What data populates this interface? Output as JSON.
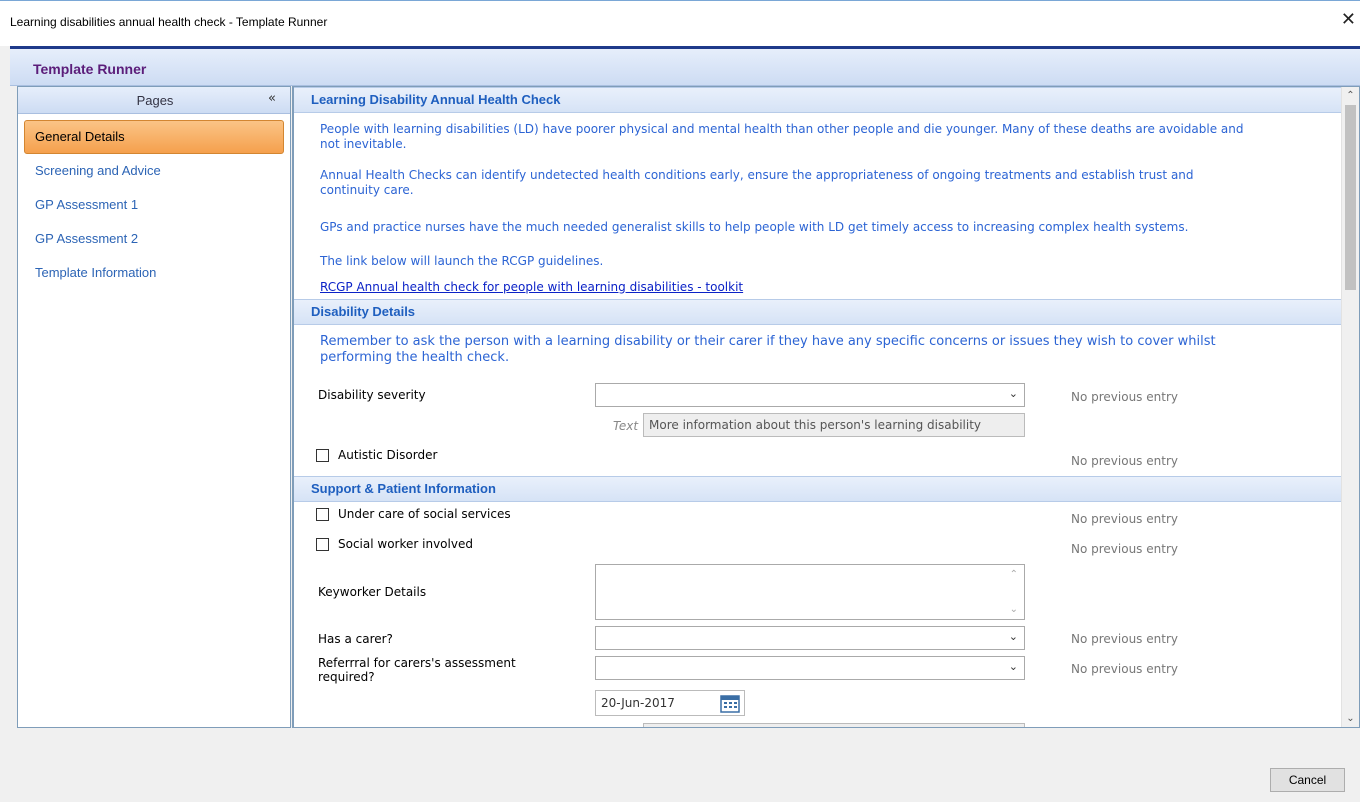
{
  "window": {
    "title": "Learning disabilities annual health check - Template Runner",
    "close_glyph": "✕"
  },
  "runner": {
    "title": "Template Runner"
  },
  "sidebar": {
    "header": "Pages",
    "collapse_glyph": "«",
    "items": [
      {
        "label": "General Details",
        "active": true
      },
      {
        "label": "Screening and Advice"
      },
      {
        "label": "GP Assessment 1"
      },
      {
        "label": "GP Assessment 2"
      },
      {
        "label": "Template Information"
      }
    ]
  },
  "sections": {
    "annual": {
      "title": "Learning Disability Annual Health Check",
      "p1_line1": "People with learning disabilities (LD) have poorer physical and mental health than other people and die younger. Many of these deaths are avoidable and",
      "p1_line2": "not inevitable.",
      "p2_line1": "Annual Health Checks can identify undetected health conditions early, ensure the appropriateness of ongoing treatments and establish trust and",
      "p2_line2": "continuity care.",
      "p3": "GPs and practice nurses have the much needed generalist skills to help people with LD get timely access to increasing complex health systems.",
      "p4": "The link below will launch the RCGP guidelines.",
      "link": "RCGP Annual health check for people with learning disabilities - toolkit"
    },
    "disability": {
      "title": "Disability Details",
      "note_line1": "Remember to ask the person with a learning disability or their carer if they have any specific concerns or issues they wish to cover whilst",
      "note_line2": "performing the health check.",
      "severity_label": "Disability severity",
      "severity_value": "",
      "severity_prev": "No previous entry",
      "text_tag": "Text",
      "text_value": "More information about this person's learning disability",
      "autistic_label": "Autistic Disorder",
      "autistic_prev": "No previous entry"
    },
    "support": {
      "title": "Support & Patient Information",
      "social_services_label": "Under care of social services",
      "social_services_prev": "No previous entry",
      "social_worker_label": "Social worker involved",
      "social_worker_prev": "No previous entry",
      "keyworker_label": "Keyworker Details",
      "carer_label": "Has a carer?",
      "carer_prev": "No previous entry",
      "referral_label_line1": "Referrral for carers's assessment",
      "referral_label_line2": "required?",
      "referral_prev": "No previous entry",
      "date_value": "20-Jun-2017"
    }
  },
  "footer": {
    "cancel_label": "Cancel"
  },
  "colors": {
    "accent": "#1e3a8a",
    "link_blue": "#2c64d4",
    "active_nav": "#f5a04d",
    "runner_title": "#5b1d7a"
  }
}
